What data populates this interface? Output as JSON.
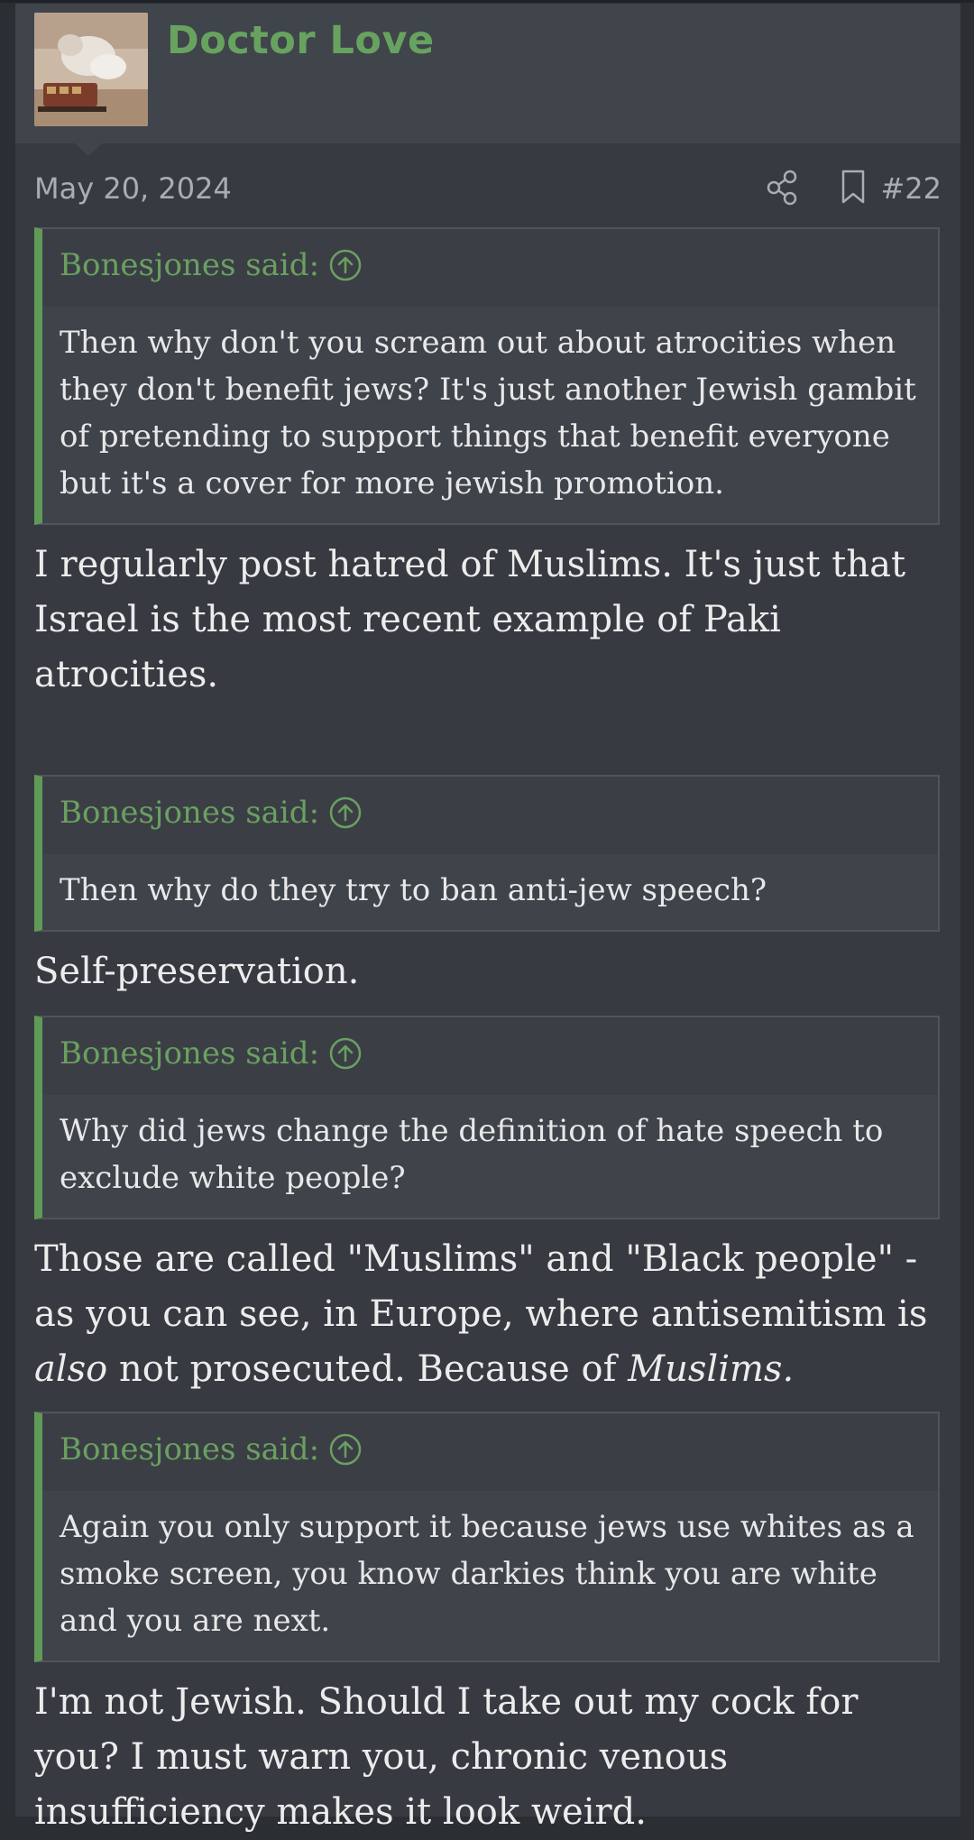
{
  "post": {
    "username": "Doctor Love",
    "date": "May 20, 2024",
    "post_number": "#22",
    "icons": {
      "share": "share-icon",
      "bookmark": "bookmark-icon",
      "avatar": "user-avatar"
    }
  },
  "blocks": [
    {
      "quote": {
        "author": "Bonesjones said:",
        "text": "Then why don't you scream out about atrocities when they don't benefit jews? It's just another Jewish gambit of pretending to support things that benefit everyone but it's a cover for more jewish promotion."
      },
      "reply": {
        "parts": [
          "I regularly post hatred of Muslims. It's just that Israel is the most recent example of Paki atrocities."
        ]
      }
    },
    {
      "quote": {
        "author": "Bonesjones said:",
        "text": "Then why do they try to ban anti-jew speech?"
      },
      "reply": {
        "parts": [
          "Self-preservation."
        ]
      }
    },
    {
      "quote": {
        "author": "Bonesjones said:",
        "text": "Why did jews change the definition of hate speech to exclude white people?"
      },
      "reply": {
        "parts": [
          "Those are called \"Muslims\" and \"Black people\" - as you can see, in Europe, where antisemitism is ",
          "also",
          " not prosecuted. Because of ",
          "Muslims."
        ]
      }
    },
    {
      "quote": {
        "author": "Bonesjones said:",
        "text": "Again you only support it because jews use whites as a smoke screen, you know darkies think you are white and you are next."
      },
      "reply": {
        "parts": [
          "I'm not Jewish. Should I take out my cock for you? I must warn you, chronic venous insufficiency makes it look weird."
        ]
      }
    }
  ],
  "colors": {
    "accent_green": "#67a35f",
    "background": "#373a40",
    "quote_bg": "#3f434a"
  }
}
